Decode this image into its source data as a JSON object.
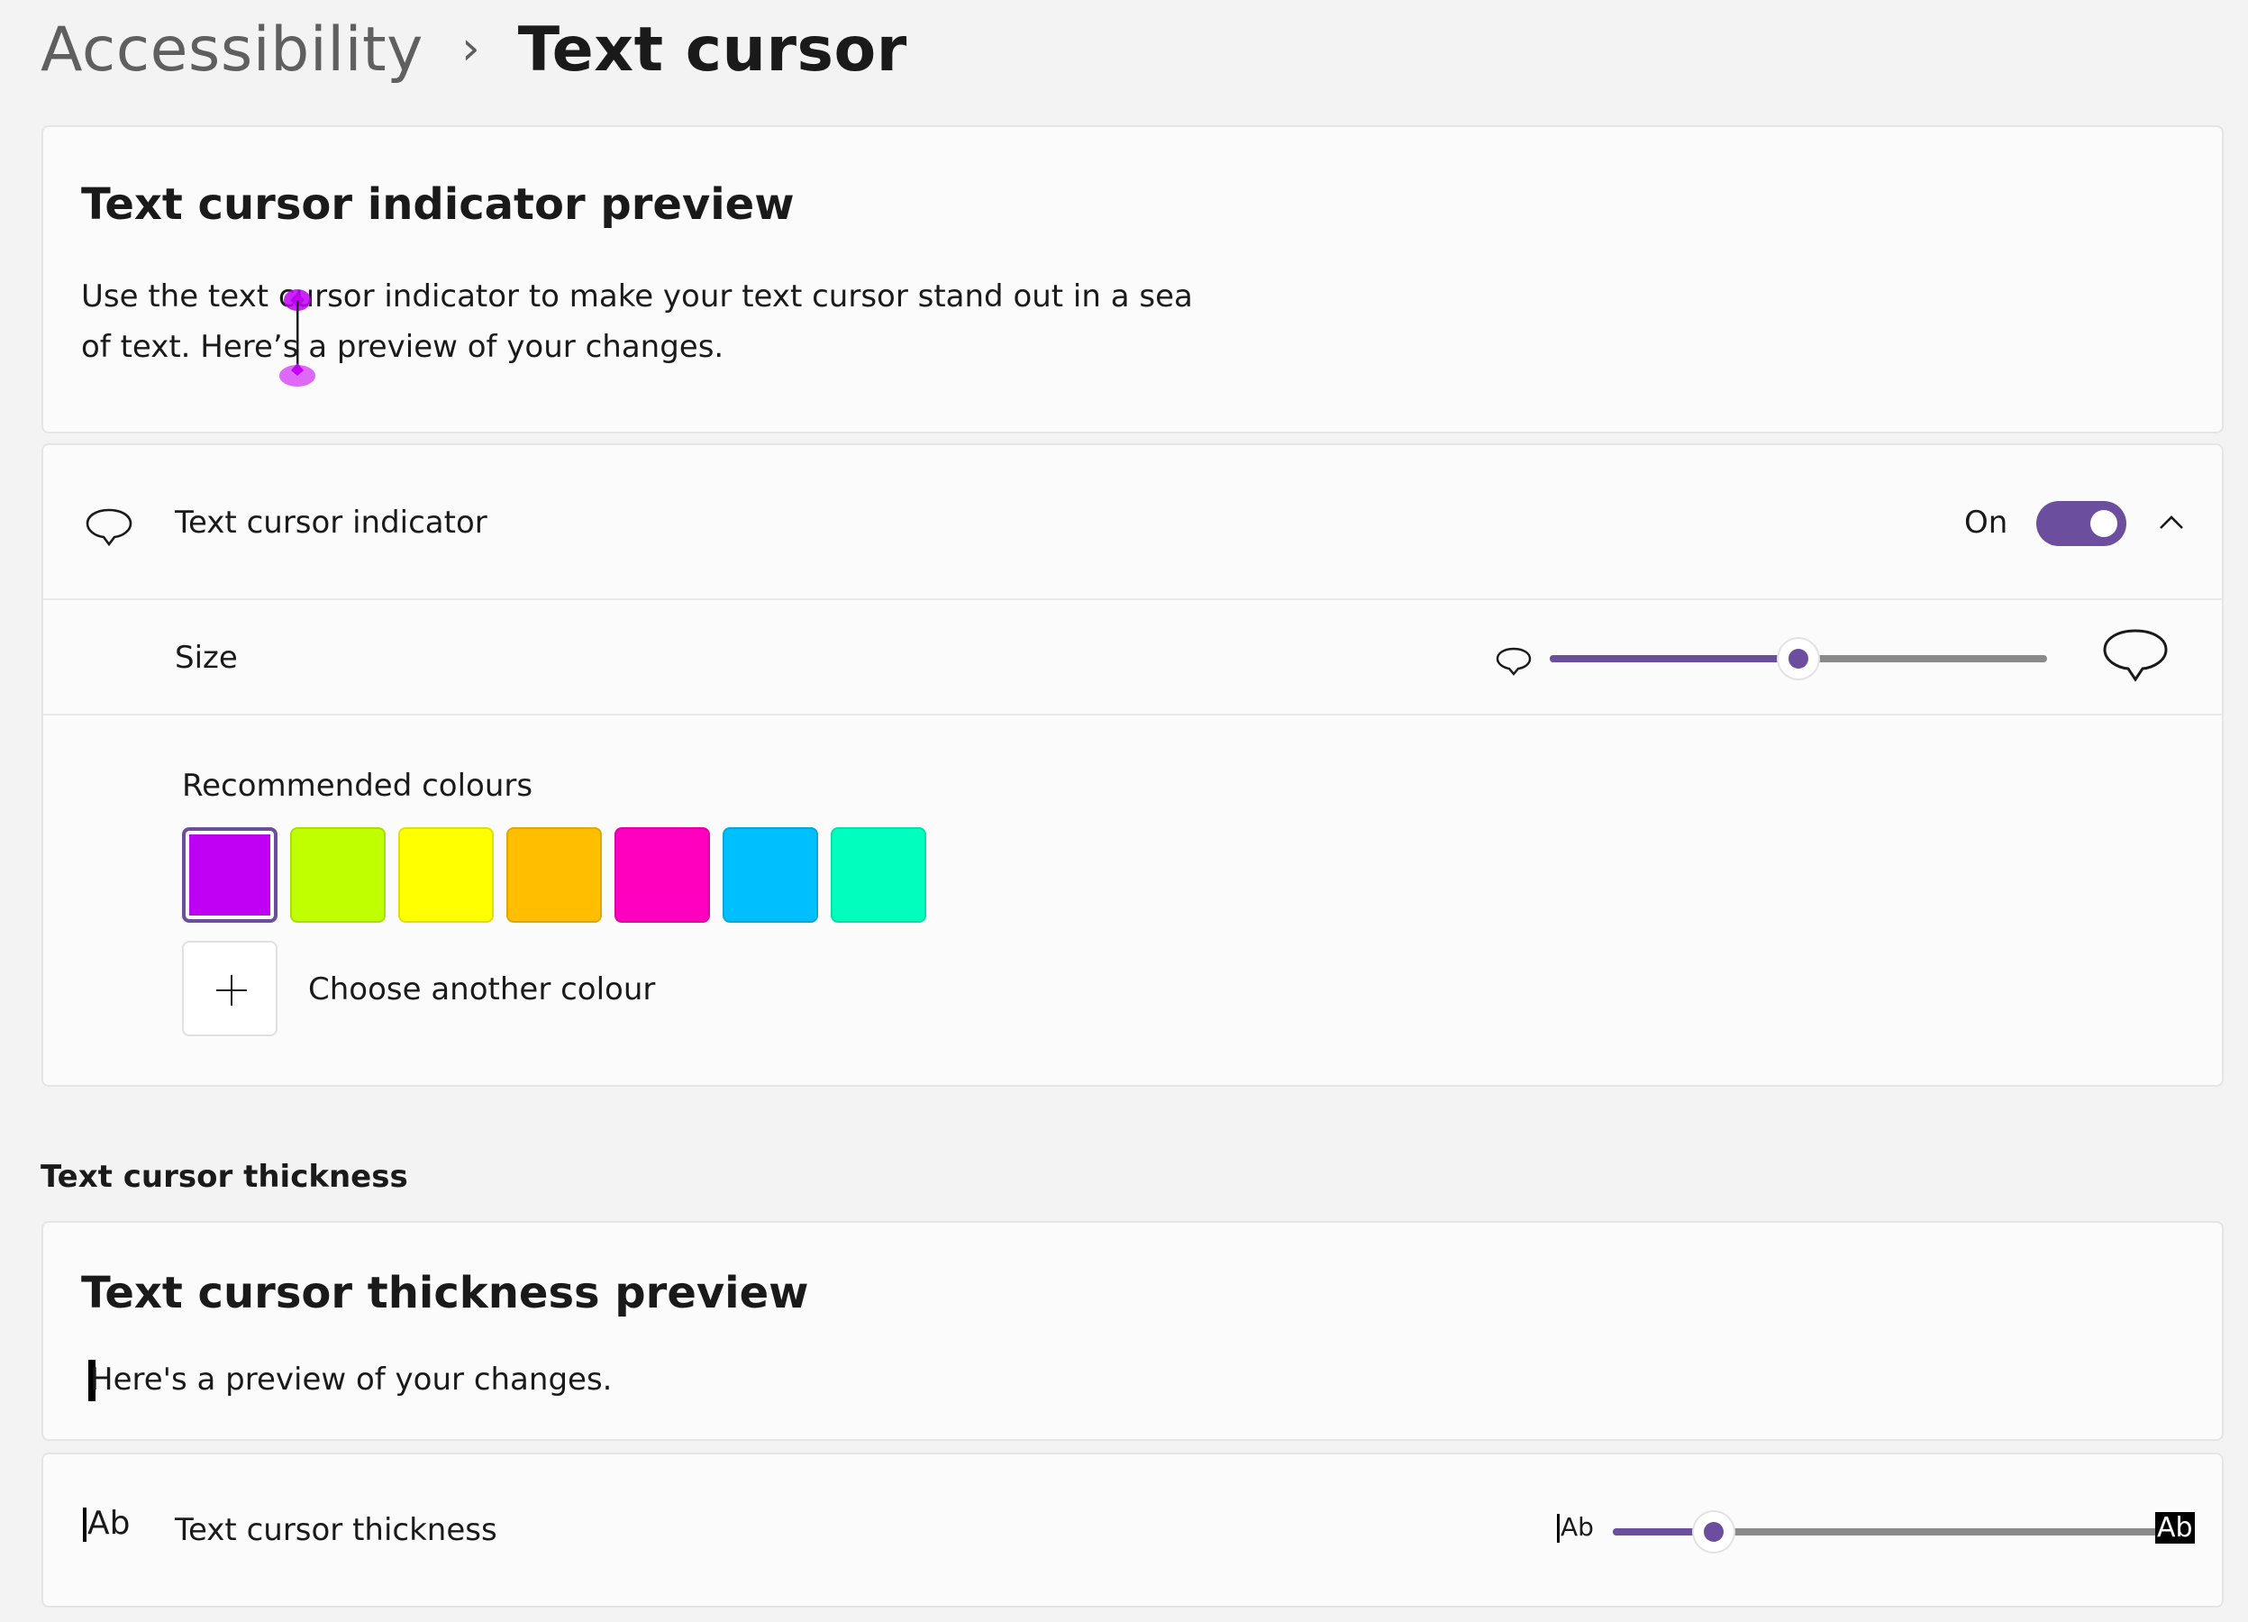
{
  "breadcrumb": {
    "parent": "Accessibility",
    "separator": "›",
    "current": "Text cursor"
  },
  "indicator_preview": {
    "title": "Text cursor indicator preview",
    "line1": "Use the text cursor indicator to make your text cursor stand out in a sea",
    "line2": "of text. Here’s a preview of your changes."
  },
  "indicator_setting": {
    "label": "Text cursor indicator",
    "toggle_state": "On",
    "enabled": true,
    "size_label": "Size",
    "size_level": 0.5,
    "colours_label": "Recommended colours",
    "colours": [
      "#c000f5",
      "#bfff00",
      "#ffff00",
      "#ffbf00",
      "#ff00bf",
      "#00bfff",
      "#00ffbf"
    ],
    "selected_colour_index": 0,
    "add_colour_label": "Choose another colour"
  },
  "thickness_section": {
    "heading": "Text cursor thickness",
    "preview_title": "Text cursor thickness preview",
    "preview_text": "Here's a preview of your changes.",
    "setting_label": "Text cursor thickness",
    "ab_small": "Ab",
    "ab_large": "Ab",
    "thickness_level": 0.18
  },
  "colors": {
    "accent": "#6b4e9e",
    "indicator": "#c000f5"
  }
}
